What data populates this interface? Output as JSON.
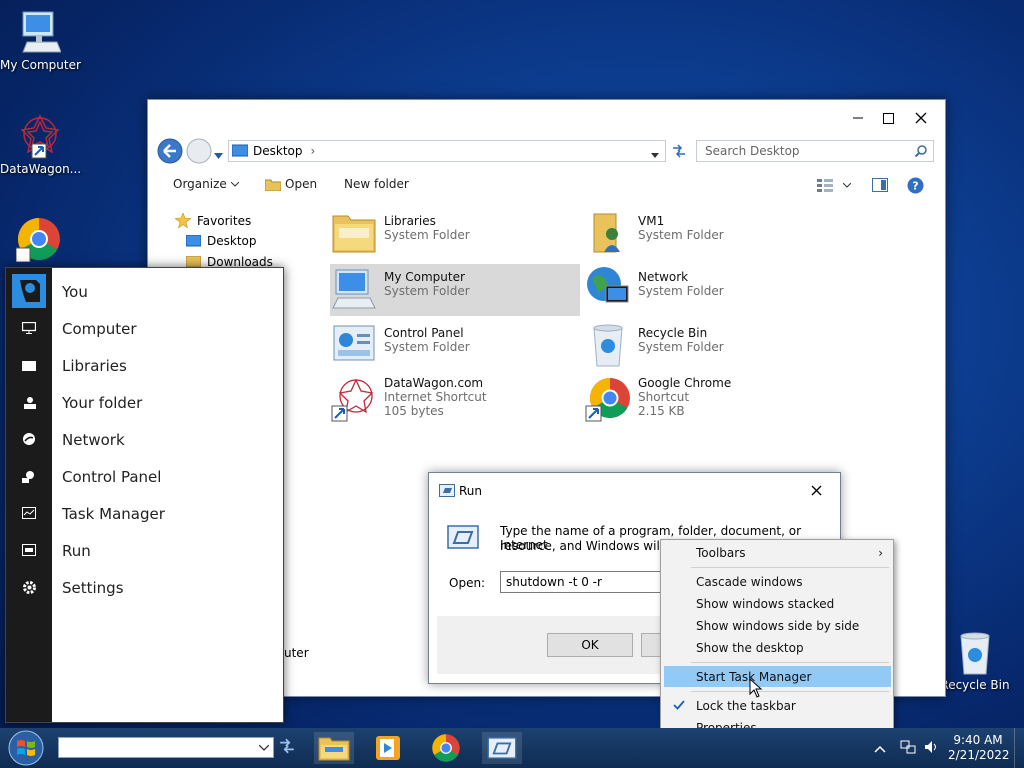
{
  "desktop": {
    "icons": [
      {
        "label": "My Computer"
      },
      {
        "label": "DataWagon..."
      },
      {
        "label": "Recycle Bin"
      }
    ]
  },
  "explorer": {
    "address": "Desktop",
    "search_placeholder": "Search Desktop",
    "toolbar": {
      "organize": "Organize",
      "open": "Open",
      "new_folder": "New folder"
    },
    "nav": {
      "favorites": "Favorites",
      "desktop": "Desktop",
      "downloads": "Downloads",
      "computer_partial": "uter"
    },
    "items": [
      {
        "name": "Libraries",
        "sub1": "System Folder",
        "sub2": ""
      },
      {
        "name": "VM1",
        "sub1": "System Folder",
        "sub2": ""
      },
      {
        "name": "My Computer",
        "sub1": "System Folder",
        "sub2": ""
      },
      {
        "name": "Network",
        "sub1": "System Folder",
        "sub2": ""
      },
      {
        "name": "Control Panel",
        "sub1": "System Folder",
        "sub2": ""
      },
      {
        "name": "Recycle Bin",
        "sub1": "System Folder",
        "sub2": ""
      },
      {
        "name": "DataWagon.com",
        "sub1": "Internet Shortcut",
        "sub2": "105 bytes"
      },
      {
        "name": "Google Chrome",
        "sub1": "Shortcut",
        "sub2": "2.15 KB"
      }
    ]
  },
  "start_menu": {
    "items": [
      {
        "label": "You"
      },
      {
        "label": "Computer"
      },
      {
        "label": "Libraries"
      },
      {
        "label": "Your folder"
      },
      {
        "label": "Network"
      },
      {
        "label": "Control Panel"
      },
      {
        "label": "Task Manager"
      },
      {
        "label": "Run"
      },
      {
        "label": "Settings"
      }
    ]
  },
  "run_dialog": {
    "title": "Run",
    "description_line1": "Type the name of a program, folder, document, or Internet",
    "description_line2": "resource, and Windows will op",
    "open_label": "Open:",
    "open_value": "shutdown -t 0 -r",
    "ok_label": "OK"
  },
  "context_menu": {
    "toolbars": "Toolbars",
    "cascade": "Cascade windows",
    "stacked": "Show windows stacked",
    "side_by_side": "Show windows side by side",
    "show_desktop": "Show the desktop",
    "start_task_manager": "Start Task Manager",
    "lock_taskbar": "Lock the taskbar",
    "properties": "Properties"
  },
  "taskbar": {
    "time": "9:40 AM",
    "date": "2/21/2022",
    "search_value": ""
  },
  "colors": {
    "accent": "#91c9f7",
    "selection": "#d9d9d9",
    "start_rail": "#1b1b1b"
  }
}
